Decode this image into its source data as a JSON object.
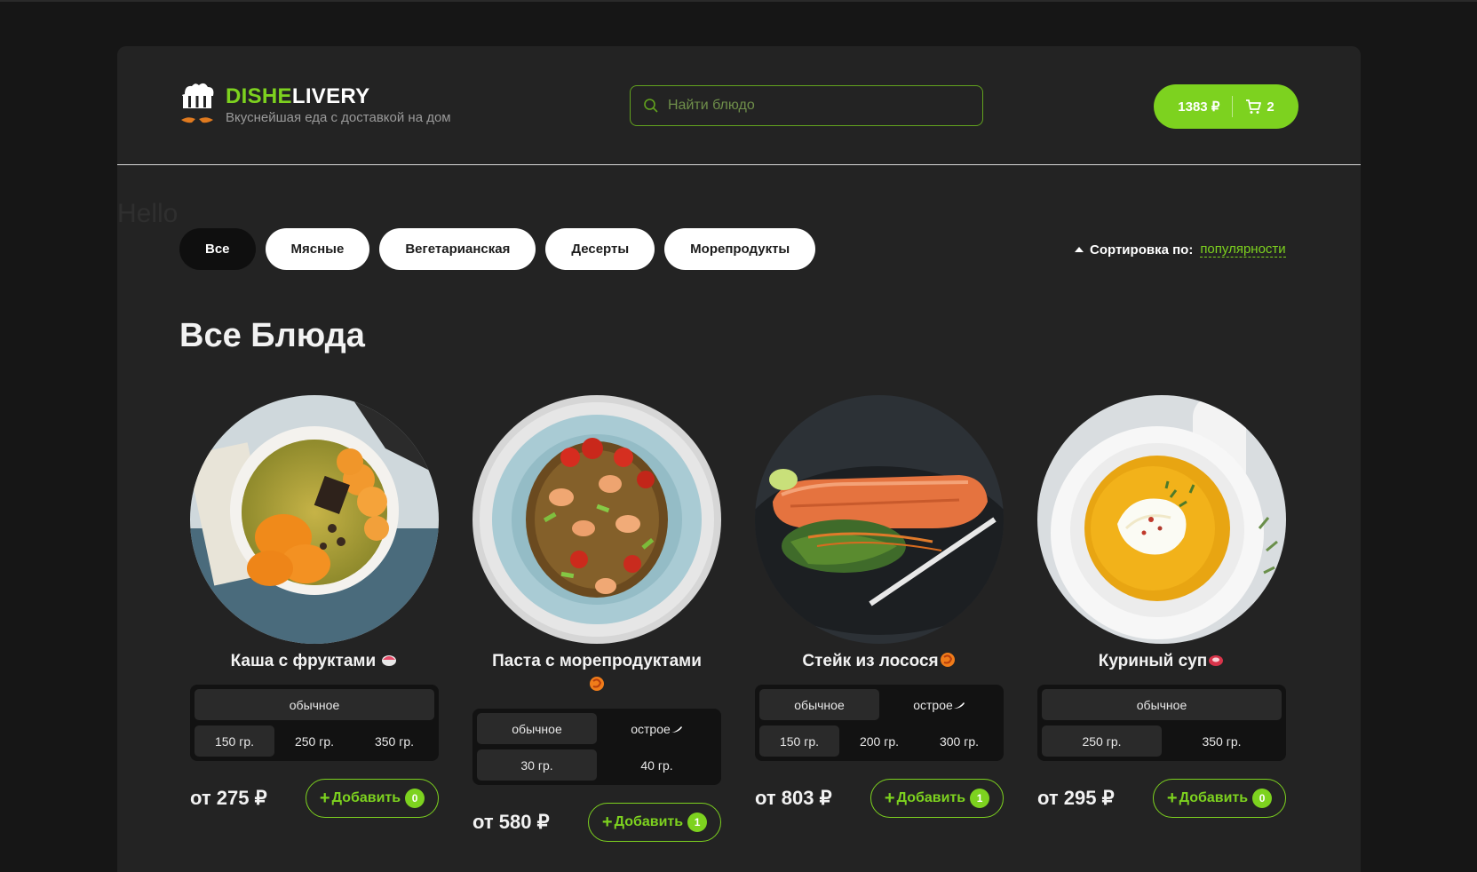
{
  "header": {
    "brand_part1": "DISHE",
    "brand_part2": "LIVERY",
    "tagline": "Вкуснейшая еда с доставкой на дом",
    "search_placeholder": "Найти блюдо",
    "cart_total": "1383 ₽",
    "cart_count": "2"
  },
  "hello_text": "Hello",
  "categories": [
    "Все",
    "Мясные",
    "Вегетарианская",
    "Десерты",
    "Морепродукты"
  ],
  "active_category": "Все",
  "sort": {
    "label": "Сортировка по:",
    "value": "популярности"
  },
  "page_title": "Все Блюда",
  "dishes": [
    {
      "name": "Каша с фруктами",
      "emoji_icon": "bowl-icon",
      "types": [
        "обычное"
      ],
      "sizes": [
        "150 гр.",
        "250 гр.",
        "350 гр."
      ],
      "selected_size": "150 гр.",
      "price": "от 275 ₽",
      "add_label": "Добавить",
      "count": "0"
    },
    {
      "name": "Паста с морепродуктами",
      "emoji_icon": "shrimp-icon",
      "types": [
        "обычное",
        "острое"
      ],
      "sizes": [
        "30 гр.",
        "40 гр."
      ],
      "selected_size": "30 гр.",
      "price": "от 580 ₽",
      "add_label": "Добавить",
      "count": "1"
    },
    {
      "name": "Стейк из лосося",
      "emoji_icon": "shrimp-icon",
      "types": [
        "обычное",
        "острое"
      ],
      "sizes": [
        "150 гр.",
        "200 гр.",
        "300 гр."
      ],
      "selected_size": "150 гр.",
      "price": "от 803 ₽",
      "add_label": "Добавить",
      "count": "1"
    },
    {
      "name": "Куриный суп",
      "emoji_icon": "meat-icon",
      "types": [
        "обычное"
      ],
      "sizes": [
        "250 гр.",
        "350 гр."
      ],
      "selected_size": "250 гр.",
      "price": "от 295 ₽",
      "add_label": "Добавить",
      "count": "0"
    }
  ],
  "colors": {
    "accent": "#7dd21f",
    "background": "#232323",
    "page_bg": "#161616"
  }
}
